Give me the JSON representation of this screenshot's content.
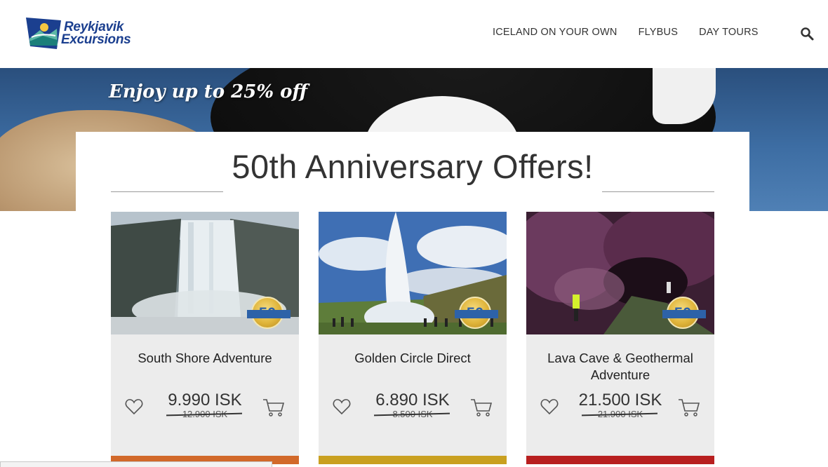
{
  "header": {
    "logo": {
      "line1": "Reykjavik",
      "line2": "Excursions"
    },
    "nav": [
      "ICELAND ON YOUR OWN",
      "FLYBUS",
      "DAY TOURS"
    ]
  },
  "hero": {
    "promo": "Enjoy up to 25% off"
  },
  "panel": {
    "title": "50th Anniversary Offers!",
    "cards": [
      {
        "name": "South Shore Adventure",
        "price": "9.990 ISK",
        "old_price": "12.900 ISK",
        "badge": "50",
        "bar_color": "#d2692a"
      },
      {
        "name": "Golden Circle Direct",
        "price": "6.890 ISK",
        "old_price": "8.500 ISK",
        "badge": "50",
        "bar_color": "#c9a020"
      },
      {
        "name": "Lava Cave & Geothermal Adventure",
        "price": "21.500 ISK",
        "old_price": "21.900 ISK",
        "badge": "50",
        "bar_color": "#b81f1f"
      }
    ]
  },
  "colors": {
    "brand": "#1b3f8f",
    "text": "#333333"
  }
}
